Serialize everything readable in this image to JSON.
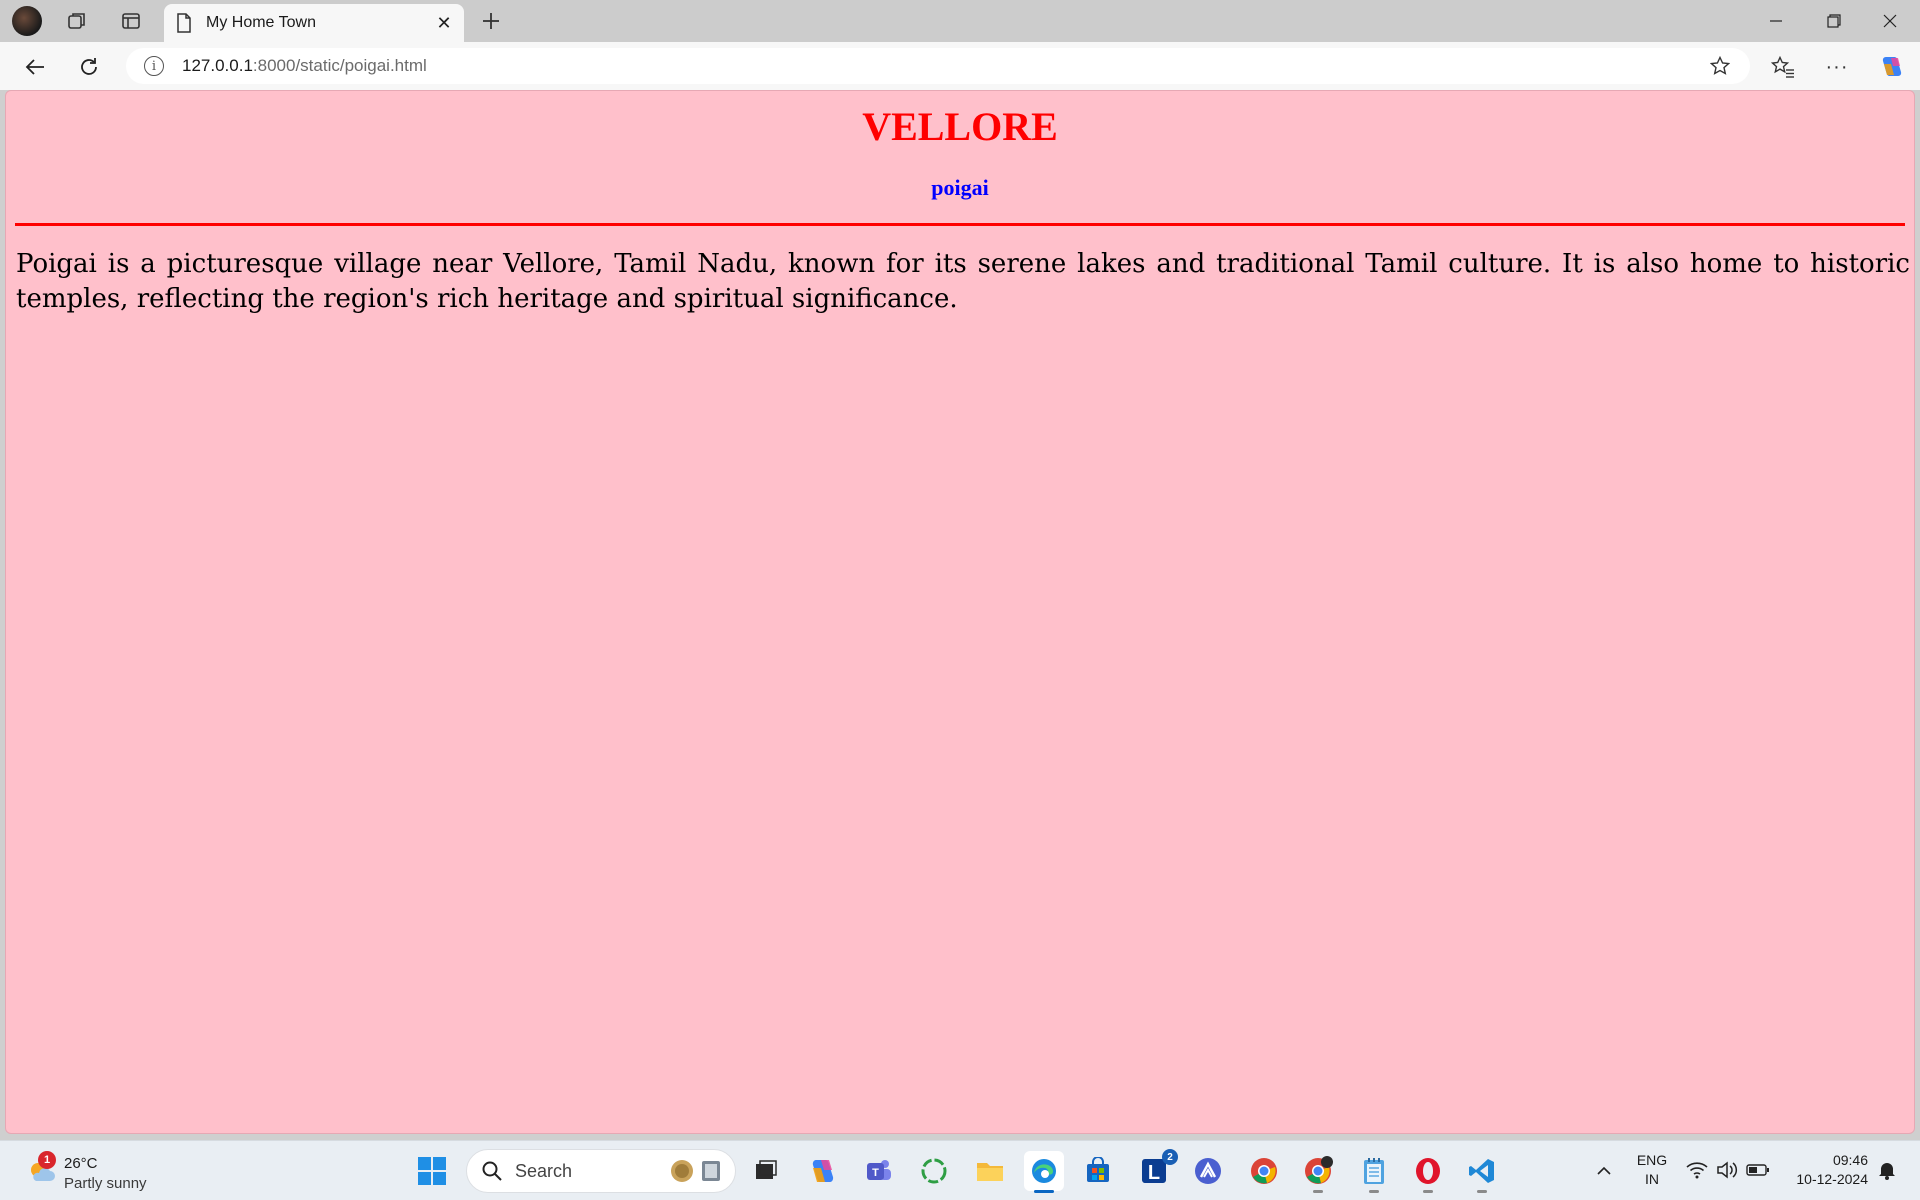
{
  "browser": {
    "tab_title": "My Home Town",
    "url_host": "127.0.0.1",
    "url_path": ":8000/static/poigai.html"
  },
  "page": {
    "background": "#ffc0cb",
    "heading": "VELLORE",
    "heading_color": "#ff0000",
    "subheading": "poigai",
    "subheading_color": "#0000ff",
    "rule_color": "#ff0000",
    "paragraph": "Poigai is a picturesque village near Vellore, Tamil Nadu, known for its serene lakes and traditional Tamil culture. It is also home to historic temples, reflecting the region's rich heritage and spiritual significance."
  },
  "taskbar": {
    "weather": {
      "badge": "1",
      "temp": "26°C",
      "condition": "Partly sunny"
    },
    "search_label": "Search",
    "apps": [
      {
        "name": "task-view",
        "icon": "task-view-icon"
      },
      {
        "name": "copilot",
        "icon": "copilot-icon"
      },
      {
        "name": "teams",
        "icon": "teams-icon"
      },
      {
        "name": "loader",
        "icon": "circle-app-icon"
      },
      {
        "name": "file-explorer",
        "icon": "folder-icon"
      },
      {
        "name": "edge",
        "icon": "edge-icon",
        "active": true
      },
      {
        "name": "store",
        "icon": "store-icon"
      },
      {
        "name": "l-app",
        "icon": "l-app-icon",
        "badge": "2"
      },
      {
        "name": "app-a",
        "icon": "triangle-app-icon"
      },
      {
        "name": "chrome",
        "icon": "chrome-icon"
      },
      {
        "name": "chrome-profile",
        "icon": "chrome-profile-icon"
      },
      {
        "name": "notepad",
        "icon": "notepad-icon"
      },
      {
        "name": "opera",
        "icon": "opera-icon"
      },
      {
        "name": "vscode",
        "icon": "vscode-icon"
      }
    ],
    "lang_line1": "ENG",
    "lang_line2": "IN",
    "time": "09:46",
    "date": "10-12-2024"
  }
}
